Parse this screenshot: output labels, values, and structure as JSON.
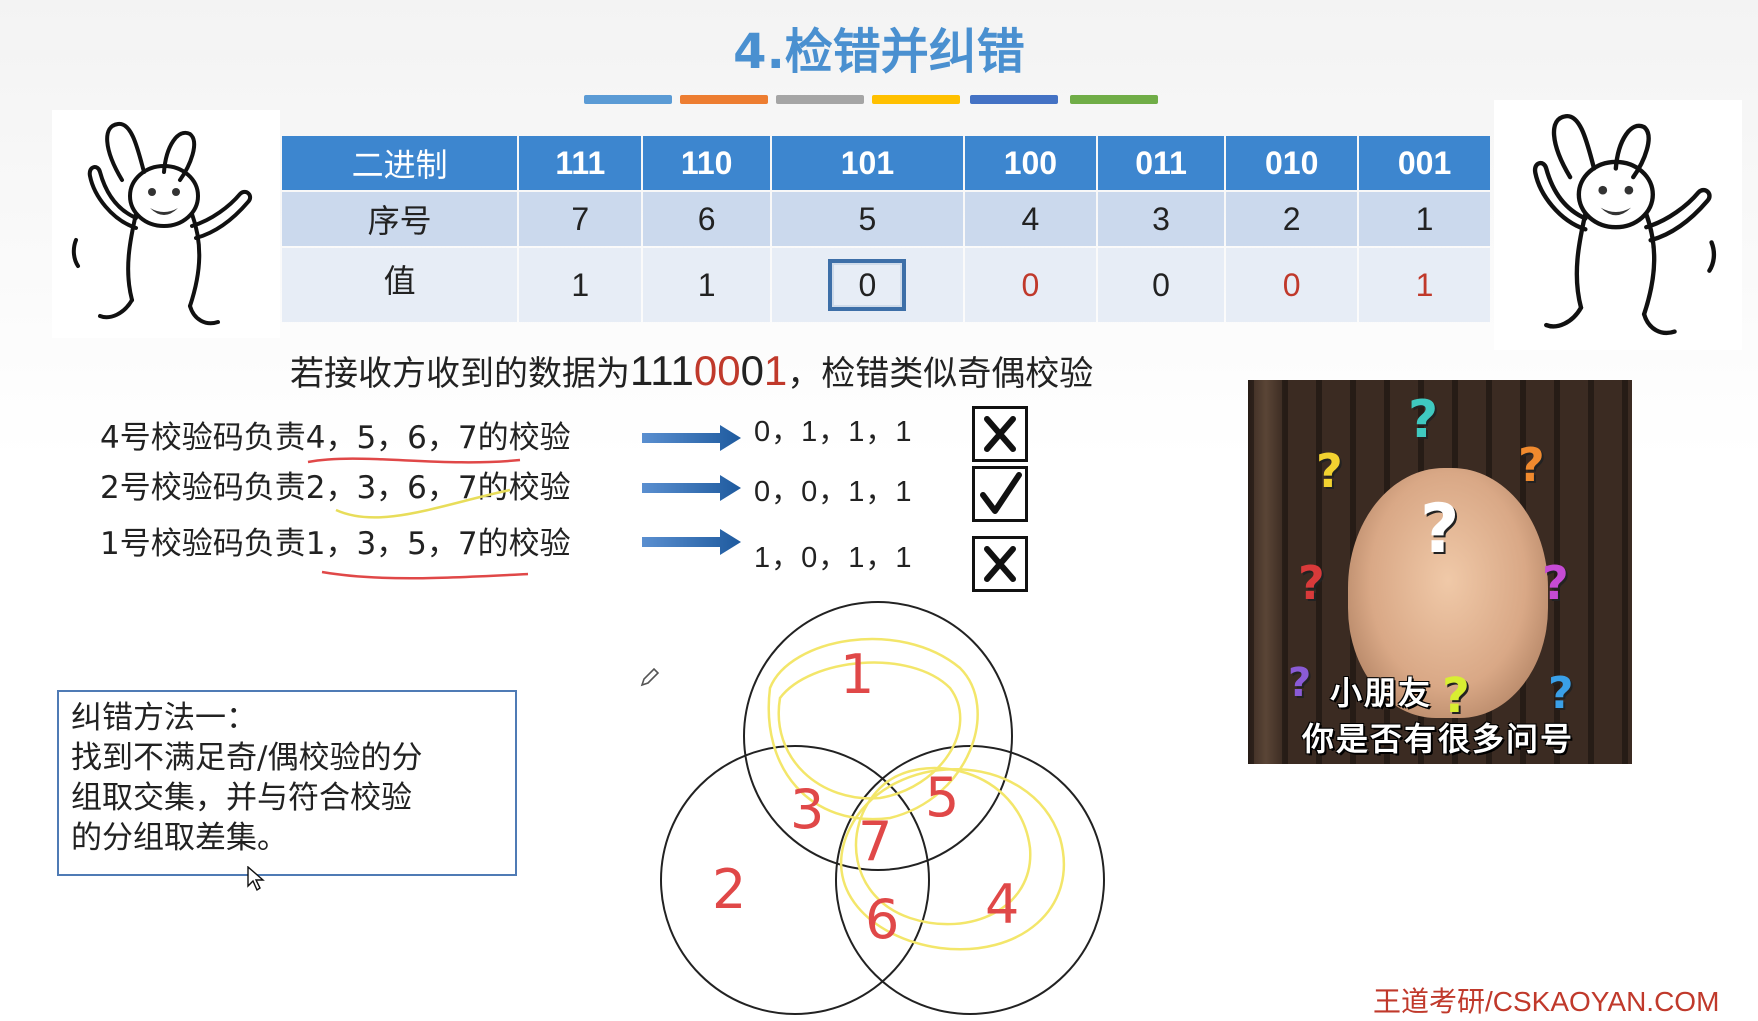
{
  "title": "4.检错并纠错",
  "accent_bars": [
    "#5b9bd5",
    "#ed7d31",
    "#a5a5a5",
    "#ffc000",
    "#4472c4",
    "#70ad47"
  ],
  "table": {
    "header_label": "二进制",
    "binary": [
      "111",
      "110",
      "101",
      "100",
      "011",
      "010",
      "001"
    ],
    "index_label": "序号",
    "index": [
      "7",
      "6",
      "5",
      "4",
      "3",
      "2",
      "1"
    ],
    "value_label": "值",
    "values": [
      "1",
      "1",
      "0",
      "0",
      "0",
      "0",
      "1"
    ]
  },
  "received_sentence": {
    "prefix": "若接收方收到的数据为",
    "digits_black": "111",
    "digits_red": "00",
    "digit_black_2": "0",
    "digit_red_2": "1",
    "suffix": "，检错类似奇偶校验"
  },
  "checks": [
    {
      "pre": "4号校验码负责",
      "bits": "4，5，6，7",
      "post": "的校验",
      "result": "0，1，1，1",
      "status": "fail"
    },
    {
      "pre": "2号校验码负责",
      "bits": "2，3，6，7",
      "post": "的校验",
      "result": "0，0，1，1",
      "status": "pass"
    },
    {
      "pre": "1号校验码负责",
      "bits": "1，3，5，7",
      "post": "的校验",
      "result": "1，0，1，1",
      "status": "fail"
    }
  ],
  "method": {
    "title": "纠错方法一：",
    "line1": "找到不满足奇/偶校验的分",
    "line2": "组取交集，并与符合校验",
    "line3": "的分组取差集。"
  },
  "meme": {
    "line1": "小朋友",
    "line2": "你是否有很多问号",
    "question_mark": "?"
  },
  "venn_labels": [
    "1",
    "2",
    "3",
    "4",
    "5",
    "6",
    "7"
  ],
  "footer": "王道考研/CSKAOYAN.COM",
  "colors": {
    "title": "#4a90d0",
    "table_header": "#3d86cf",
    "error_red": "#c0392b",
    "highlight_yellow": "#f3e66a"
  }
}
